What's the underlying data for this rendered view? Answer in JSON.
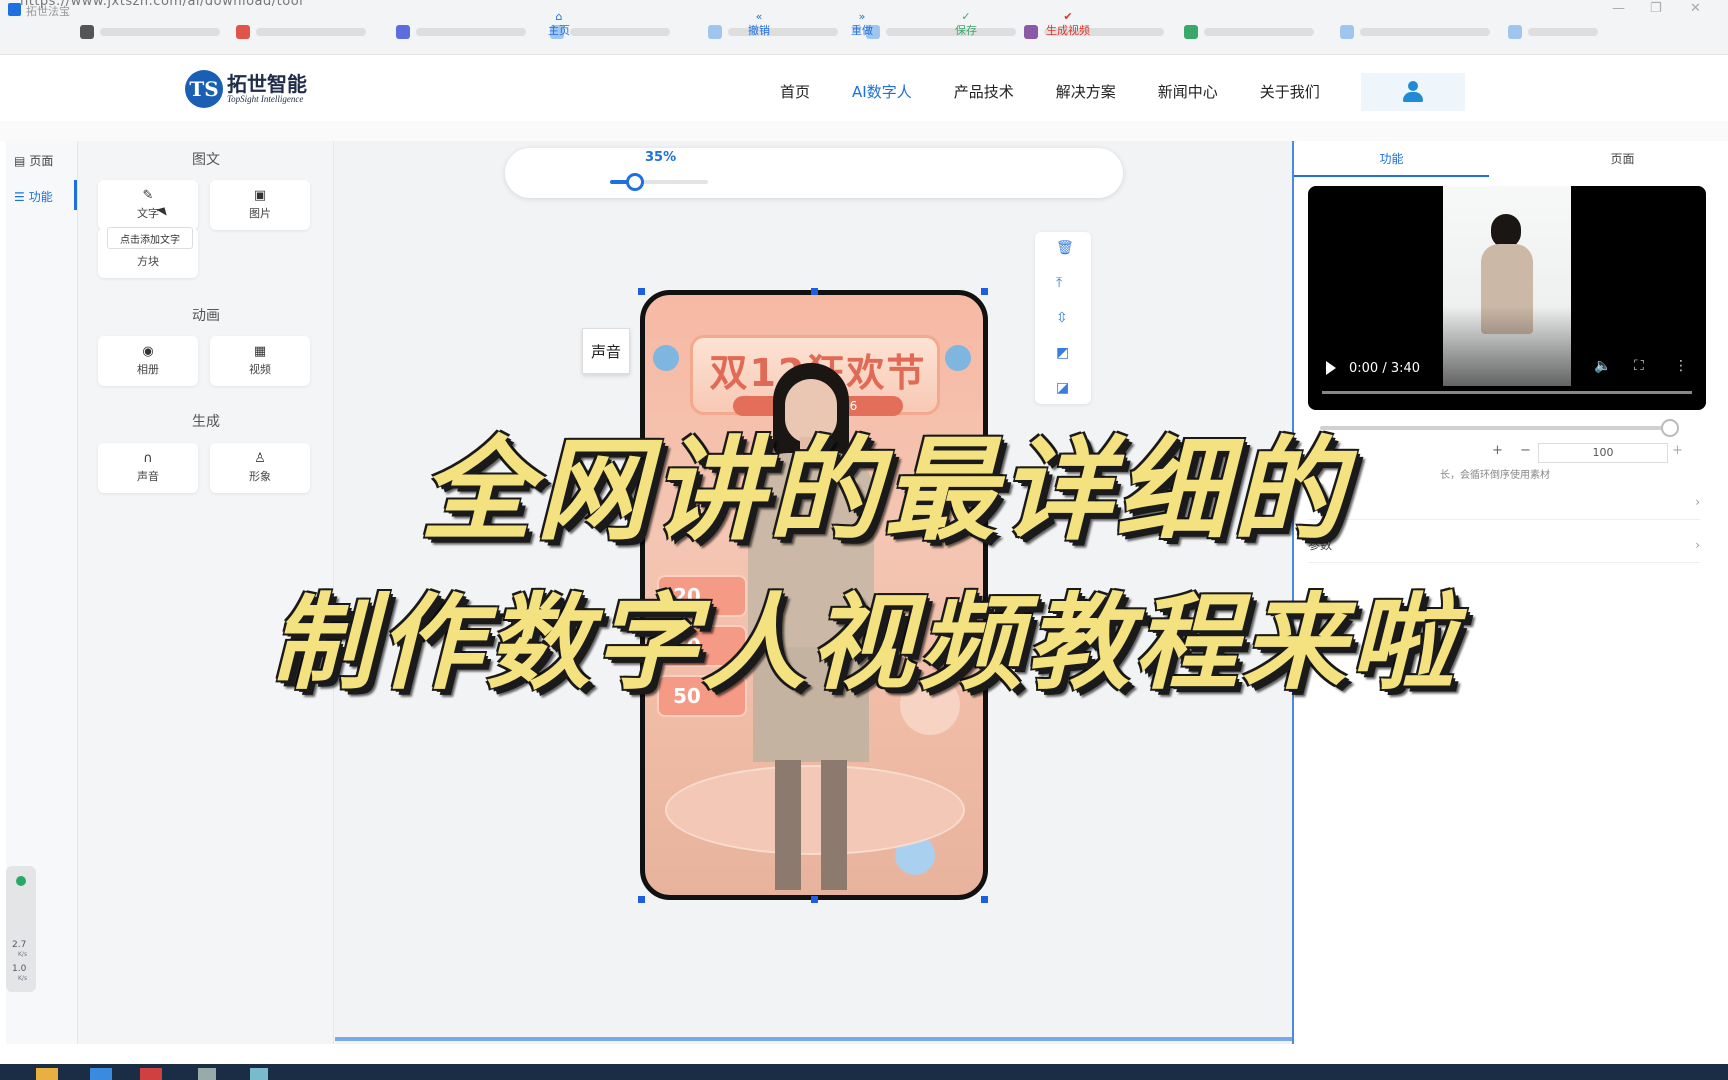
{
  "browser": {
    "url": "https://www.jxtszn.com/ai/download/tool"
  },
  "site": {
    "logo_cn": "拓世智能",
    "logo_en": "TopSight Intelligence",
    "nav": [
      {
        "label": "首页",
        "active": false
      },
      {
        "label": "AI数字人",
        "active": true
      },
      {
        "label": "产品技术",
        "active": false
      },
      {
        "label": "解决方案",
        "active": false
      },
      {
        "label": "新闻中心",
        "active": false
      },
      {
        "label": "关于我们",
        "active": false
      }
    ]
  },
  "app": {
    "title": "拓世法宝",
    "rail": [
      {
        "label": "页面",
        "icon": "page-icon"
      },
      {
        "label": "功能",
        "icon": "sliders-icon"
      }
    ],
    "sections": {
      "text_image": "图文",
      "animation": "动画",
      "generate": "生成"
    },
    "tools": {
      "text": "文字",
      "image": "图片",
      "block": "方块",
      "album": "相册",
      "video": "视频",
      "voice": "声音",
      "avatar": "形象"
    },
    "tooltip": "点击添加文字"
  },
  "toolbar": {
    "home": "主页",
    "zoom": "35%",
    "zoom_level": 0.35,
    "undo": "撤销",
    "redo": "重做",
    "save": "保存",
    "generate": "生成视频"
  },
  "canvas": {
    "voice_tag": "声音",
    "banner_title": "双12狂欢节",
    "banner_sub": "千库... 买1送6",
    "promo_numbers": [
      "20",
      "30",
      "50"
    ]
  },
  "right_panel": {
    "tabs": [
      "功能",
      "页面"
    ],
    "video_time": "0:00 / 3:40",
    "number_value": "100",
    "hint": "长，会循环倒序使用素材",
    "params_label": "参数"
  },
  "monitor": {
    "up": "2.7",
    "down": "1.0",
    "unit": "K/s"
  },
  "overlay": {
    "line1": "全网讲的最详细的",
    "line2": "制作数字人视频教程来啦"
  },
  "colors": {
    "accent": "#1e6fe0",
    "headline": "#f3e27f",
    "save_green": "#3aa86a",
    "generate_red": "#e0342c"
  }
}
